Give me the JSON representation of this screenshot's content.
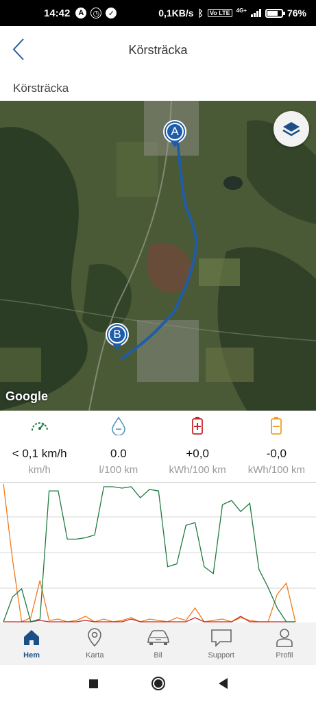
{
  "status_bar": {
    "time": "14:42",
    "left_icons": [
      "A",
      "alarm-icon",
      "check-icon"
    ],
    "network_speed": "0,1KB/s",
    "net_badge": "4G+",
    "volte_badge": "Vo LTE",
    "battery_percent": 76,
    "battery_label": "76%"
  },
  "header": {
    "title": "Körsträcka",
    "back_icon": "chevron-left-icon"
  },
  "section": {
    "label": "Körsträcka"
  },
  "map": {
    "marker_start": "A",
    "marker_end": "B",
    "attribution": "Google",
    "route_color": "#1f5da8",
    "layers_icon": "layers-icon"
  },
  "metrics": [
    {
      "icon": "speedometer-icon",
      "color": "#1f7a3e",
      "value": "< 0,1 km/h",
      "unit": "km/h"
    },
    {
      "icon": "fuel-drop-icon",
      "color": "#4a8fb8",
      "value": "0.0",
      "unit": "l/100 km"
    },
    {
      "icon": "battery-plus-icon",
      "color": "#c0282d",
      "value": "+0,0",
      "unit": "kWh/100 km"
    },
    {
      "icon": "battery-minus-icon",
      "color": "#f0a020",
      "value": "-0,0",
      "unit": "kWh/100 km"
    }
  ],
  "chart_data": {
    "type": "line",
    "series": [
      {
        "color": "#1f7a3e",
        "values": [
          0,
          18,
          24,
          0,
          2,
          95,
          95,
          60,
          60,
          61,
          63,
          98,
          98,
          97,
          98,
          90,
          96,
          95,
          40,
          42,
          70,
          72,
          40,
          35,
          85,
          88,
          80,
          86,
          38,
          25,
          10,
          0,
          0
        ]
      },
      {
        "color": "#f07a1a",
        "values": [
          100,
          45,
          0,
          3,
          30,
          1,
          2,
          0,
          1,
          4,
          0,
          2,
          0,
          1,
          3,
          0,
          2,
          1,
          0,
          3,
          1,
          10,
          0,
          1,
          2,
          0,
          3,
          1,
          0,
          0,
          20,
          28,
          0
        ]
      },
      {
        "color": "#c0282d",
        "values": [
          0,
          0,
          0,
          0,
          1,
          0,
          0,
          0,
          0,
          1,
          0,
          0,
          0,
          0,
          2,
          0,
          0,
          0,
          0,
          0,
          0,
          3,
          0,
          0,
          0,
          0,
          4,
          0,
          0,
          0,
          0,
          0,
          0
        ]
      }
    ],
    "ylim": [
      0,
      100
    ],
    "grid": true
  },
  "bottom_nav": [
    {
      "icon": "home-icon",
      "label": "Hem",
      "active": true
    },
    {
      "icon": "map-pin-icon",
      "label": "Karta",
      "active": false
    },
    {
      "icon": "car-icon",
      "label": "Bil",
      "active": false
    },
    {
      "icon": "chat-bubble-icon",
      "label": "Support",
      "active": false
    },
    {
      "icon": "person-icon",
      "label": "Profil",
      "active": false
    }
  ]
}
